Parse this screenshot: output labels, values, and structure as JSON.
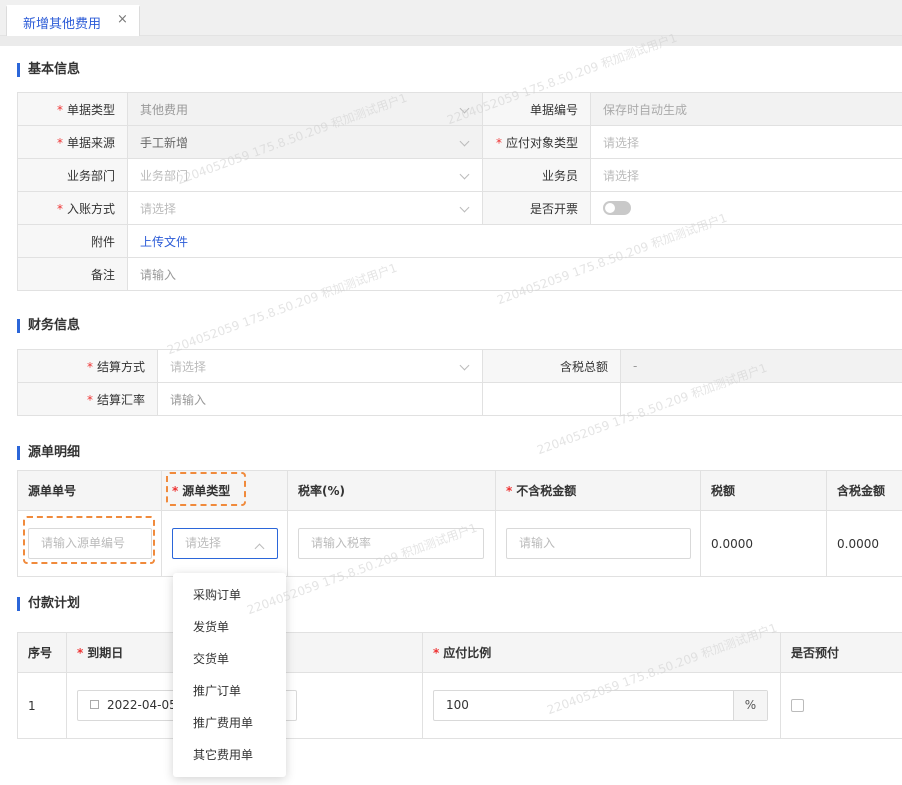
{
  "tab": {
    "label": "新增其他费用",
    "close": "×"
  },
  "sections": {
    "basic": "基本信息",
    "finance": "财务信息",
    "source": "源单明细",
    "payment": "付款计划"
  },
  "basic": {
    "doc_type_label": "单据类型",
    "doc_type_value": "其他费用",
    "doc_no_label": "单据编号",
    "doc_no_value": "保存时自动生成",
    "doc_source_label": "单据来源",
    "doc_source_value": "手工新增",
    "payee_type_label": "应付对象类型",
    "payee_type_placeholder": "请选择",
    "dept_label": "业务部门",
    "dept_placeholder": "业务部门",
    "salesman_label": "业务员",
    "salesman_placeholder": "请选择",
    "entry_label": "入账方式",
    "entry_placeholder": "请选择",
    "invoice_label": "是否开票",
    "attach_label": "附件",
    "attach_link": "上传文件",
    "remark_label": "备注",
    "remark_placeholder": "请输入"
  },
  "finance": {
    "settle_label": "结算方式",
    "settle_placeholder": "请选择",
    "total_label": "含税总额",
    "total_value": "-",
    "rate_label": "结算汇率",
    "rate_placeholder": "请输入"
  },
  "source": {
    "headers": [
      "源单单号",
      "源单类型",
      "税率(%)",
      "不含税金额",
      "税额",
      "含税金额"
    ],
    "no_placeholder": "请输入源单编号",
    "type_placeholder": "请选择",
    "tax_placeholder": "请输入税率",
    "amount_placeholder": "请输入",
    "tax_value": "0.0000",
    "total_value": "0.0000",
    "dropdown": [
      "采购订单",
      "发货单",
      "交货单",
      "推广订单",
      "推广费用单",
      "其它费用单"
    ]
  },
  "payment": {
    "headers": [
      "序号",
      "到期日",
      "应付比例",
      "是否预付"
    ],
    "row_no": "1",
    "date": "2022-04-05",
    "ratio": "100",
    "unit": "%"
  },
  "watermark": "2204052059 175.8.50.209 积加测试用户1",
  "colors": {
    "accent": "#2b66d9",
    "highlight": "#f08a3c",
    "required": "#e33333"
  }
}
